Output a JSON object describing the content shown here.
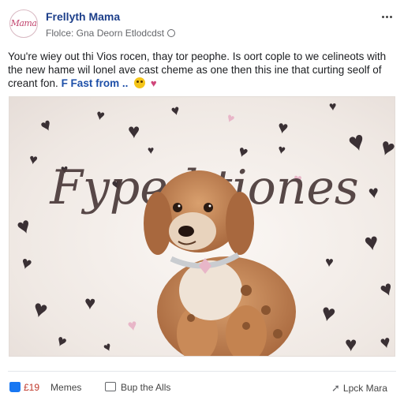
{
  "post": {
    "author": "Frellyth Mama",
    "avatar_text": "Mama",
    "meta": "Flolce: Gna Deorn Etlodcdst",
    "text_line1": "You're wiey out thi Vios rocen, thay tor peophe. Is oort cople to we celineots with",
    "text_line2": "the new hame wil lonel ave cast cheme as one then this ine that curting seolf of",
    "text_line3": "creant fon.",
    "link_text": "F Fast from ..",
    "icons": [
      "globe-icon",
      "more-icon",
      "smile-emoji-icon",
      "heart-emoji-icon"
    ]
  },
  "photo": {
    "script_text": "Fyped tiones",
    "subject": "puppy-photo",
    "colors": {
      "heart": "#3a3034",
      "pink_heart": "#e8b6c8",
      "background": "#f3ede9"
    }
  },
  "actions": {
    "like_count": "£19",
    "like_label": "Memes",
    "comment_label": "Bup the Alls",
    "share_label": "Lpck Mara"
  },
  "colors": {
    "accent": "#1877f2",
    "name": "#1d3f8a",
    "link": "#1d4fa8"
  }
}
